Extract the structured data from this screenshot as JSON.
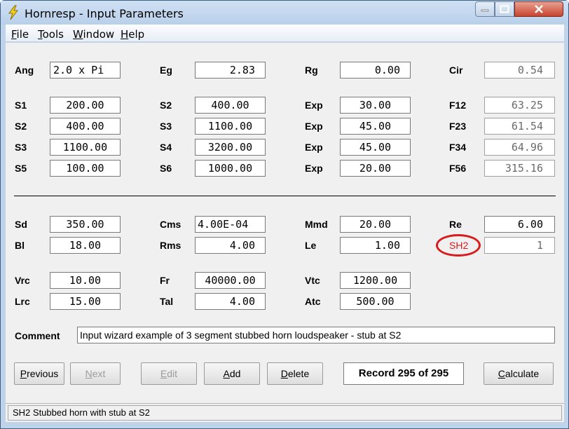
{
  "window": {
    "title": "Hornresp - Input Parameters"
  },
  "menu": [
    {
      "accel": "F",
      "rest": "ile"
    },
    {
      "accel": "T",
      "rest": "ools"
    },
    {
      "accel": "W",
      "rest": "indow"
    },
    {
      "accel": "H",
      "rest": "elp"
    }
  ],
  "fields": {
    "ang": {
      "label": "Ang",
      "value": "2.0 x Pi"
    },
    "eg": {
      "label": "Eg",
      "value": "2.83"
    },
    "rg": {
      "label": "Rg",
      "value": "0.00"
    },
    "cir": {
      "label": "Cir",
      "value": "0.54"
    },
    "s1": {
      "label": "S1",
      "value": "200.00"
    },
    "s2a": {
      "label": "S2",
      "value": "400.00"
    },
    "exp1": {
      "label": "Exp",
      "value": "30.00"
    },
    "f12": {
      "label": "F12",
      "value": "63.25"
    },
    "s2b": {
      "label": "S2",
      "value": "400.00"
    },
    "s3a": {
      "label": "S3",
      "value": "1100.00"
    },
    "exp2": {
      "label": "Exp",
      "value": "45.00"
    },
    "f23": {
      "label": "F23",
      "value": "61.54"
    },
    "s3b": {
      "label": "S3",
      "value": "1100.00"
    },
    "s4": {
      "label": "S4",
      "value": "3200.00"
    },
    "exp3": {
      "label": "Exp",
      "value": "45.00"
    },
    "f34": {
      "label": "F34",
      "value": "64.96"
    },
    "s5": {
      "label": "S5",
      "value": "100.00"
    },
    "s6": {
      "label": "S6",
      "value": "1000.00"
    },
    "exp4": {
      "label": "Exp",
      "value": "20.00"
    },
    "f56": {
      "label": "F56",
      "value": "315.16"
    },
    "sd": {
      "label": "Sd",
      "value": "350.00"
    },
    "cms": {
      "label": "Cms",
      "value": "4.00E-04"
    },
    "mmd": {
      "label": "Mmd",
      "value": "20.00"
    },
    "re": {
      "label": "Re",
      "value": "6.00"
    },
    "bl": {
      "label": "Bl",
      "value": "18.00"
    },
    "rms": {
      "label": "Rms",
      "value": "4.00"
    },
    "le": {
      "label": "Le",
      "value": "1.00"
    },
    "sh2": {
      "label": "SH2",
      "value": "1"
    },
    "vrc": {
      "label": "Vrc",
      "value": "10.00"
    },
    "fr": {
      "label": "Fr",
      "value": "40000.00"
    },
    "vtc": {
      "label": "Vtc",
      "value": "1200.00"
    },
    "lrc": {
      "label": "Lrc",
      "value": "15.00"
    },
    "tal": {
      "label": "Tal",
      "value": "4.00"
    },
    "atc": {
      "label": "Atc",
      "value": "500.00"
    }
  },
  "comment": {
    "label": "Comment",
    "value": "Input wizard example of 3 segment stubbed horn loudspeaker - stub at S2"
  },
  "buttons": {
    "previous": {
      "accel": "P",
      "rest": "revious"
    },
    "next": {
      "accel": "N",
      "rest": "ext"
    },
    "edit": {
      "accel": "E",
      "rest": "dit"
    },
    "add": {
      "accel": "A",
      "rest": "dd"
    },
    "delete": {
      "accel": "D",
      "rest": "elete"
    },
    "calculate": {
      "accel": "C",
      "rest": "alculate"
    }
  },
  "record": "Record 295 of 295",
  "status": "SH2   Stubbed horn with stub at S2",
  "colors": {
    "highlight_ring": "#d81b1b",
    "window_frame": "#bfd4ea",
    "panel": "#f0f0f0"
  },
  "icons": [
    "lightning-app-icon",
    "minimize-icon",
    "maximize-icon",
    "close-icon"
  ]
}
